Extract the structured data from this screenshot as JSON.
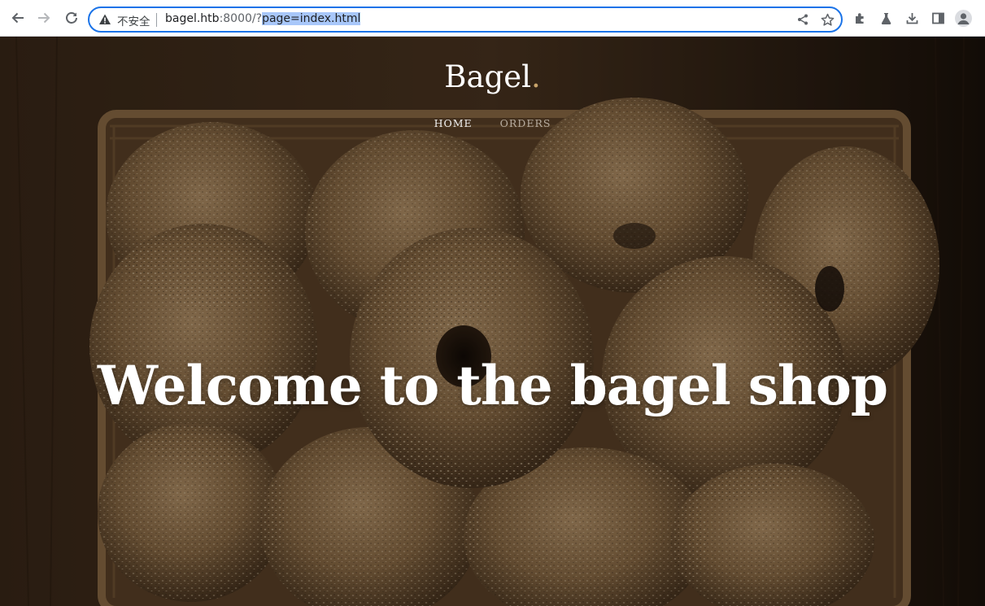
{
  "browser": {
    "security_label": "不安全",
    "url": {
      "host": "bagel.htb",
      "port_path": ":8000/?",
      "selected_query": "page=index.html"
    },
    "icons": {
      "back": "back-arrow-icon",
      "forward": "forward-arrow-icon",
      "reload": "reload-icon",
      "warning": "warning-icon",
      "share": "share-icon",
      "bookmark": "star-icon",
      "extensions": "puzzle-icon",
      "labs": "flask-icon",
      "downloads": "download-icon",
      "side_panel": "side-panel-icon",
      "profile": "profile-avatar-icon"
    },
    "colors": {
      "focus_ring": "#1a73e8",
      "selection": "#a8c7fa"
    }
  },
  "site": {
    "brand": "Bagel",
    "brand_dot": ".",
    "nav": [
      {
        "label": "HOME"
      },
      {
        "label": "ORDERS"
      }
    ],
    "headline": "Welcome to the bagel shop",
    "hero_image": "basket-of-sesame-bagels"
  }
}
